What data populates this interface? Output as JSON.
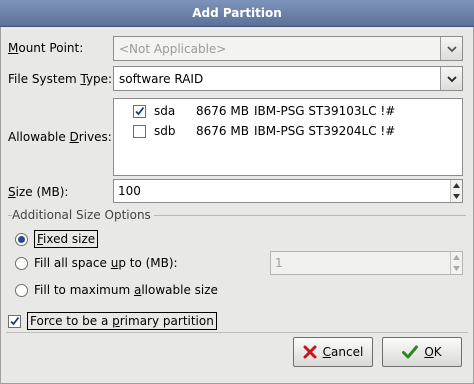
{
  "window": {
    "title": "Add Partition"
  },
  "mount_point": {
    "label_pre": "",
    "label_u": "M",
    "label_post": "ount Point:",
    "value": "<Not Applicable>"
  },
  "fs_type": {
    "label_pre": "File System ",
    "label_u": "T",
    "label_post": "ype:",
    "value": "software RAID"
  },
  "drives": {
    "label_pre": "Allowable ",
    "label_u": "D",
    "label_post": "rives:",
    "items": [
      {
        "checked": true,
        "name": "sda",
        "size": "8676 MB",
        "model": "IBM-PSG ST39103LC !#"
      },
      {
        "checked": false,
        "name": "sdb",
        "size": "8676 MB",
        "model": "IBM-PSG ST39204LC !#"
      }
    ]
  },
  "size": {
    "label_pre": "",
    "label_u": "S",
    "label_post": "ize (MB):",
    "value": "100"
  },
  "additional": {
    "title": "Additional Size Options",
    "fixed": {
      "pre": "",
      "u": "F",
      "post": "ixed size",
      "selected": true
    },
    "fill_upto": {
      "pre": "Fill all space ",
      "u": "u",
      "post": "p to (MB):",
      "selected": false,
      "value": "1"
    },
    "fill_max": {
      "pre": "Fill to maximum ",
      "u": "a",
      "post": "llowable size",
      "selected": false
    }
  },
  "primary": {
    "pre": "Force to be a ",
    "u": "p",
    "post": "rimary partition",
    "checked": true
  },
  "buttons": {
    "cancel": {
      "pre": "",
      "u": "C",
      "post": "ancel"
    },
    "ok": {
      "pre": "",
      "u": "O",
      "post": "K"
    }
  },
  "icons": {
    "cancel": "red-x-icon",
    "ok": "green-check-icon",
    "combo": "chevron-down-icon"
  }
}
